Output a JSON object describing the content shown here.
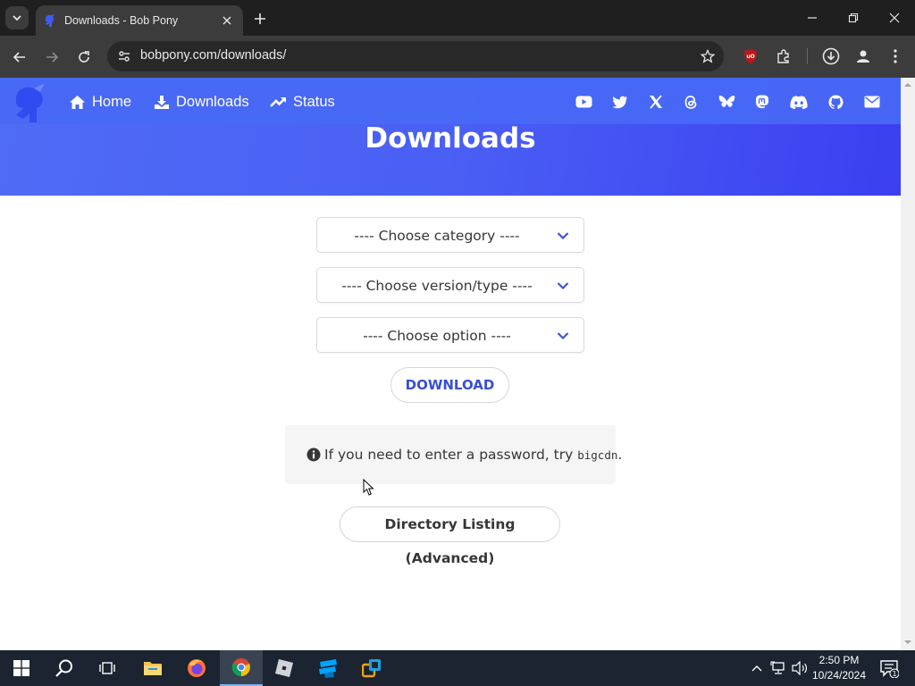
{
  "browser": {
    "tab_title": "Downloads - Bob Pony",
    "url": "bobpony.com/downloads/"
  },
  "navbar": {
    "links": [
      {
        "label": "Home",
        "icon": "home-icon"
      },
      {
        "label": "Downloads",
        "icon": "download-icon"
      },
      {
        "label": "Status",
        "icon": "trending-up-icon"
      }
    ],
    "social_icons": [
      "youtube-icon",
      "twitter-icon",
      "x-icon",
      "threads-icon",
      "bluesky-icon",
      "mastodon-icon",
      "discord-icon",
      "github-icon",
      "mail-icon"
    ]
  },
  "page": {
    "title": "Downloads",
    "selects": [
      {
        "label": "---- Choose category ----"
      },
      {
        "label": "---- Choose version/type ----"
      },
      {
        "label": "---- Choose option ----"
      }
    ],
    "download_label": "DOWNLOAD",
    "notice_text": "If you need to enter a password, try",
    "notice_code": "bigcdn",
    "notice_end": ".",
    "directory_label": "Directory Listing (Advanced)"
  },
  "taskbar": {
    "time": "2:50 PM",
    "date": "10/24/2024",
    "notification_count": "1"
  },
  "colors": {
    "accent": "#4868f6",
    "hero_end": "#3b3ff0",
    "button_text": "#3850cf"
  }
}
